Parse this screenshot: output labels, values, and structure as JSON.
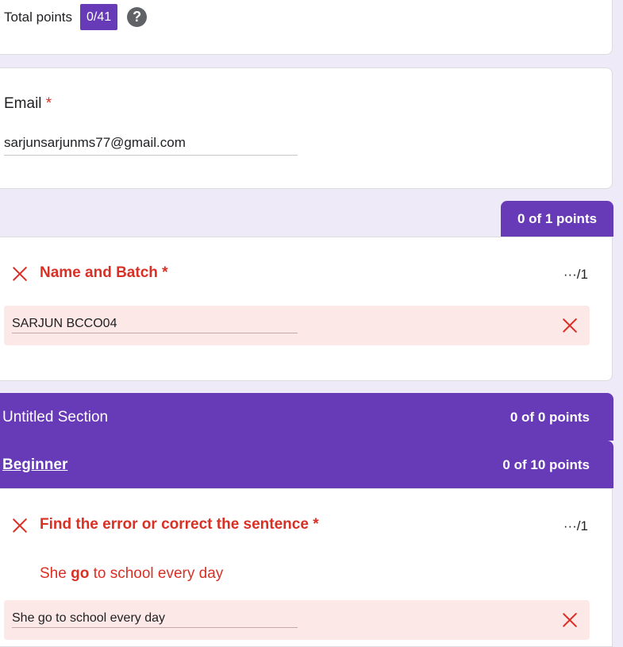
{
  "total": {
    "label": "Total points",
    "badge": "0/41",
    "help_icon": "?"
  },
  "email": {
    "label": "Email",
    "required": "*",
    "value": "sarjunsarjunms77@gmail.com"
  },
  "points_tab": "0 of 1 points",
  "name_question": {
    "title": "Name and Batch",
    "required": "*",
    "score": "···/1",
    "answer": "SARJUN BCCO04"
  },
  "sections": [
    {
      "title": "Untitled Section",
      "points": "0 of 0 points"
    },
    {
      "title": "Beginner",
      "points": "0 of 10 points"
    }
  ],
  "q1": {
    "title": "Find the error or correct the sentence",
    "required": "*",
    "score": "···/1",
    "sentence_pre": "She ",
    "sentence_bold": "go",
    "sentence_post": " to school every day",
    "answer": "She go to school every day"
  },
  "colors": {
    "accent": "#673ab7",
    "error": "#d93025",
    "error_bg": "#fce8e6"
  }
}
